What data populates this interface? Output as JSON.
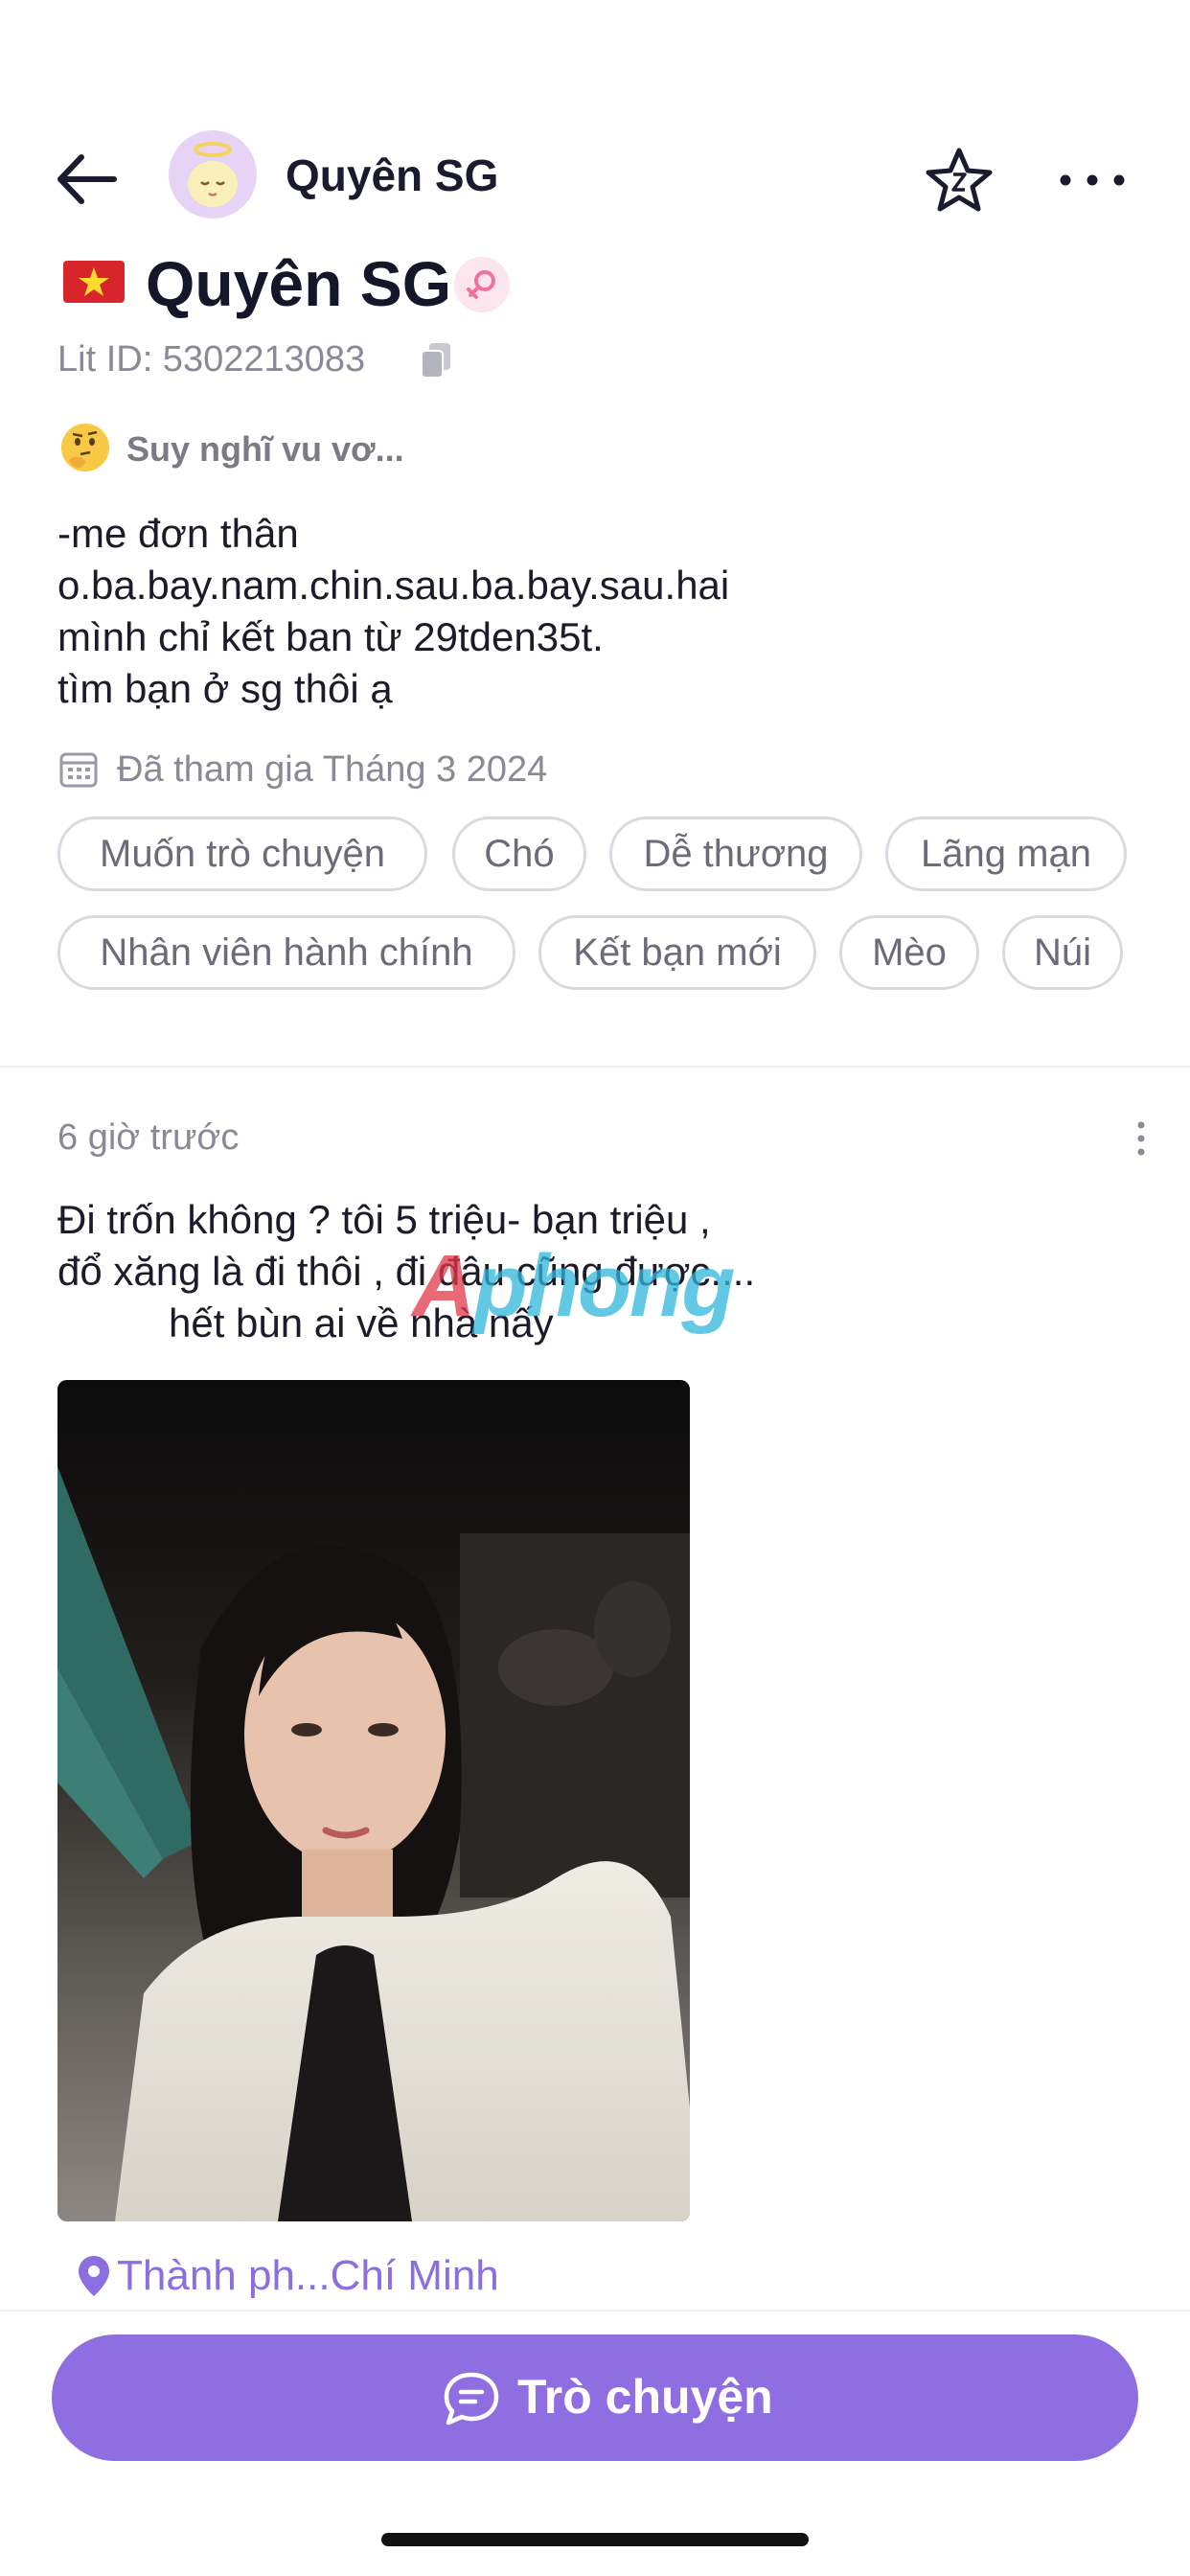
{
  "header": {
    "back_icon": "arrow-left-icon",
    "name": "Quyên SG",
    "favorite_icon": "star-icon",
    "more_icon": "more-horizontal-icon"
  },
  "profile": {
    "flag_icon": "vietnam-flag-icon",
    "name": "Quyên SG",
    "gender_icon": "female-symbol-icon",
    "lit_id": "Lit ID: 5302213083",
    "mood_text": "Suy nghĩ vu vơ...",
    "bio_lines": [
      "-me đơn thân",
      "o.ba.bay.nam.chin.sau.ba.bay.sau.hai",
      "mình chỉ kết ban từ 29tden35t.",
      "tìm bạn ở sg thôi ạ"
    ],
    "joined": "Đã tham gia Tháng 3 2024",
    "tags": [
      "Muốn trò chuyện",
      "Chó",
      "Dễ thương",
      "Lãng mạn",
      "Nhân viên hành chính",
      "Kết bạn mới",
      "Mèo",
      "Núi"
    ]
  },
  "post": {
    "time": "6 giờ trước",
    "text_lines": [
      "Đi trốn không ? tôi 5 triệu- bạn triệu ,",
      "đổ xăng là đi thôi , đi đâu cũng được....",
      "hết bùn ai về nhà nấy"
    ],
    "watermark_prefix": "A",
    "watermark_rest": "phong",
    "location": "Thành ph...Chí Minh"
  },
  "footer": {
    "chat_label": "Trò chuyện"
  },
  "colors": {
    "accent": "#8f6ee2",
    "location": "#8b6fe0",
    "muted": "#8a8a96",
    "tag_border": "#d9d9e0"
  }
}
